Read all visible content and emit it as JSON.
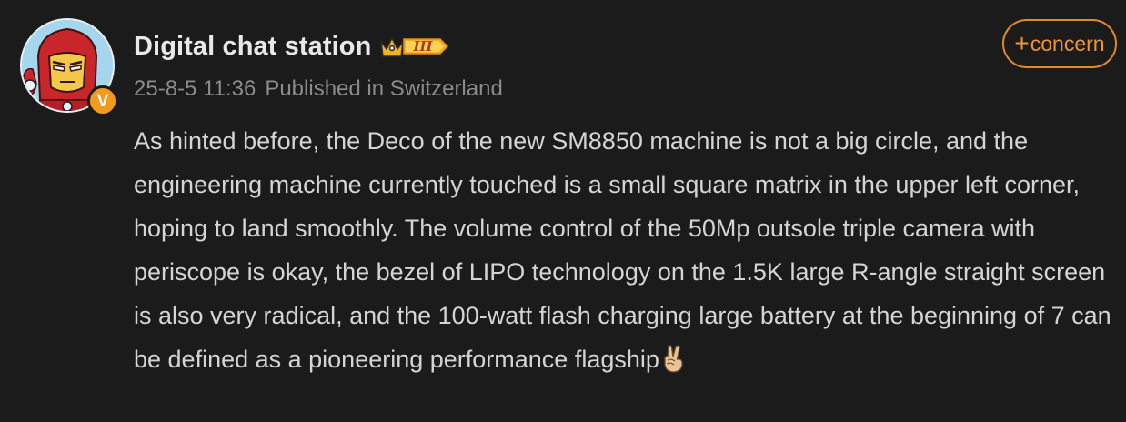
{
  "post": {
    "author": {
      "name": "Digital chat station",
      "level_badge": "III",
      "verified_mark": "V",
      "avatar_icon": "iron-man-avatar-icon"
    },
    "meta": {
      "datetime": "25-8-5 11:36",
      "location": "Published in Switzerland"
    },
    "follow_button": {
      "plus": "+",
      "label": "concern"
    },
    "body_text": "As hinted before, the Deco of the new SM8850 machine is not a big circle, and the engineering machine currently touched is a small square matrix in the upper left corner, hoping to land smoothly. The volume control of the 50Mp outsole triple camera with periscope is okay, the bezel of LIPO technology on the 1.5K large R-angle straight screen is also very radical, and the 100-watt flash charging large battery at the beginning of 7 can be defined as a pioneering performance flagship",
    "trailing_emoji": "victory-hand-icon"
  },
  "colors": {
    "background": "#1b1b1b",
    "accent": "#ee9435",
    "meta": "#8b8b8b",
    "text": "#d4d4d4",
    "badge_gold": "#f2b322"
  }
}
